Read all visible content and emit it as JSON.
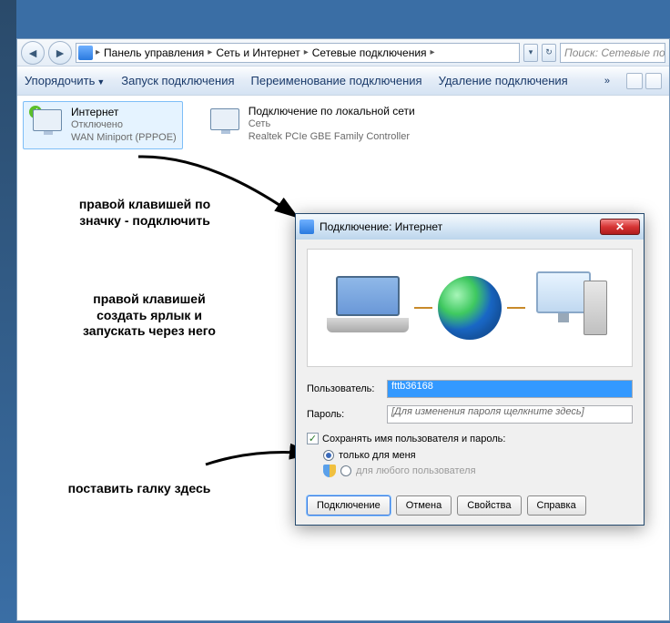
{
  "address_bar": {
    "crumb1": "Панель управления",
    "crumb2": "Сеть и Интернет",
    "crumb3": "Сетевые подключения"
  },
  "search_placeholder": "Поиск: Сетевые под",
  "toolbar": {
    "organize": "Упорядочить",
    "start": "Запуск подключения",
    "rename": "Переименование подключения",
    "delete": "Удаление подключения",
    "more": "»"
  },
  "connections": {
    "c1_title": "Интернет",
    "c1_status": "Отключено",
    "c1_device": "WAN Miniport (PPPOE)",
    "c2_title": "Подключение по локальной сети",
    "c2_status": "Сеть",
    "c2_device": "Realtek PCIe GBE Family Controller"
  },
  "annotations": {
    "a1": "правой клавишей по\nзначку - подключить",
    "a2": "правой клавишей\nсоздать ярлык и\nзапускать через него",
    "a3": "поставить галку здесь"
  },
  "dialog": {
    "title": "Подключение: Интернет",
    "user_label": "Пользователь:",
    "user_value": "fttb36168",
    "pass_label": "Пароль:",
    "pass_value": "[Для изменения пароля щелкните здесь]",
    "save_label": "Сохранять имя пользователя и пароль:",
    "only_me": "только для меня",
    "any_user": "для любого пользователя",
    "btn_connect": "Подключение",
    "btn_cancel": "Отмена",
    "btn_props": "Свойства",
    "btn_help": "Справка",
    "close": "✕"
  }
}
